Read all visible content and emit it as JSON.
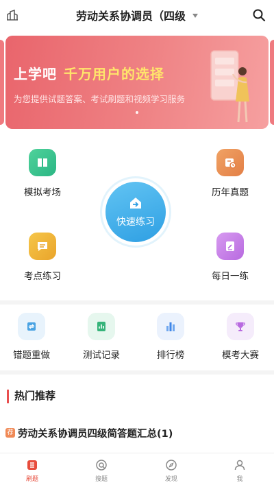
{
  "header": {
    "title": "劳动关系协调员（四级",
    "left_icon": "building-icon",
    "search_icon": "search-icon"
  },
  "banner": {
    "headline_a": "上学吧",
    "headline_b": "千万用户的选择",
    "subline": "为您提供试题答案、考试刷题和视频学习服务",
    "colors": {
      "bg_start": "#e9656c",
      "bg_end": "#f6a0a0",
      "highlight": "#ffe56b"
    }
  },
  "grid": {
    "tiles": [
      {
        "label": "模拟考场",
        "icon": "book-icon",
        "color": "#2bb684"
      },
      {
        "label": "历年真题",
        "icon": "calendar-clock-icon",
        "color": "#e37f46"
      },
      {
        "label": "考点练习",
        "icon": "message-lines-icon",
        "color": "#e9a42a"
      },
      {
        "label": "每日一练",
        "icon": "pencil-note-icon",
        "color": "#b86ae0"
      }
    ],
    "fast": {
      "label": "快速练习",
      "icon": "house-arrow-icon",
      "color": "#2e9fe3"
    }
  },
  "row2": {
    "items": [
      {
        "label": "错题重做",
        "icon": "swap-icon"
      },
      {
        "label": "测试记录",
        "icon": "bar-doc-icon"
      },
      {
        "label": "排行榜",
        "icon": "bar-chart-icon"
      },
      {
        "label": "模考大赛",
        "icon": "trophy-icon"
      }
    ]
  },
  "recommend": {
    "title": "热门推荐",
    "items": [
      {
        "tag": "荐",
        "text": "劳动关系协调员四级简答题汇总(1)"
      }
    ]
  },
  "nav": {
    "items": [
      {
        "label": "刷题",
        "icon": "list-icon",
        "active": true
      },
      {
        "label": "搜题",
        "icon": "search-circle-icon",
        "active": false
      },
      {
        "label": "发现",
        "icon": "compass-icon",
        "active": false
      },
      {
        "label": "我",
        "icon": "user-icon",
        "active": false
      }
    ],
    "active_color": "#e74c3c"
  }
}
